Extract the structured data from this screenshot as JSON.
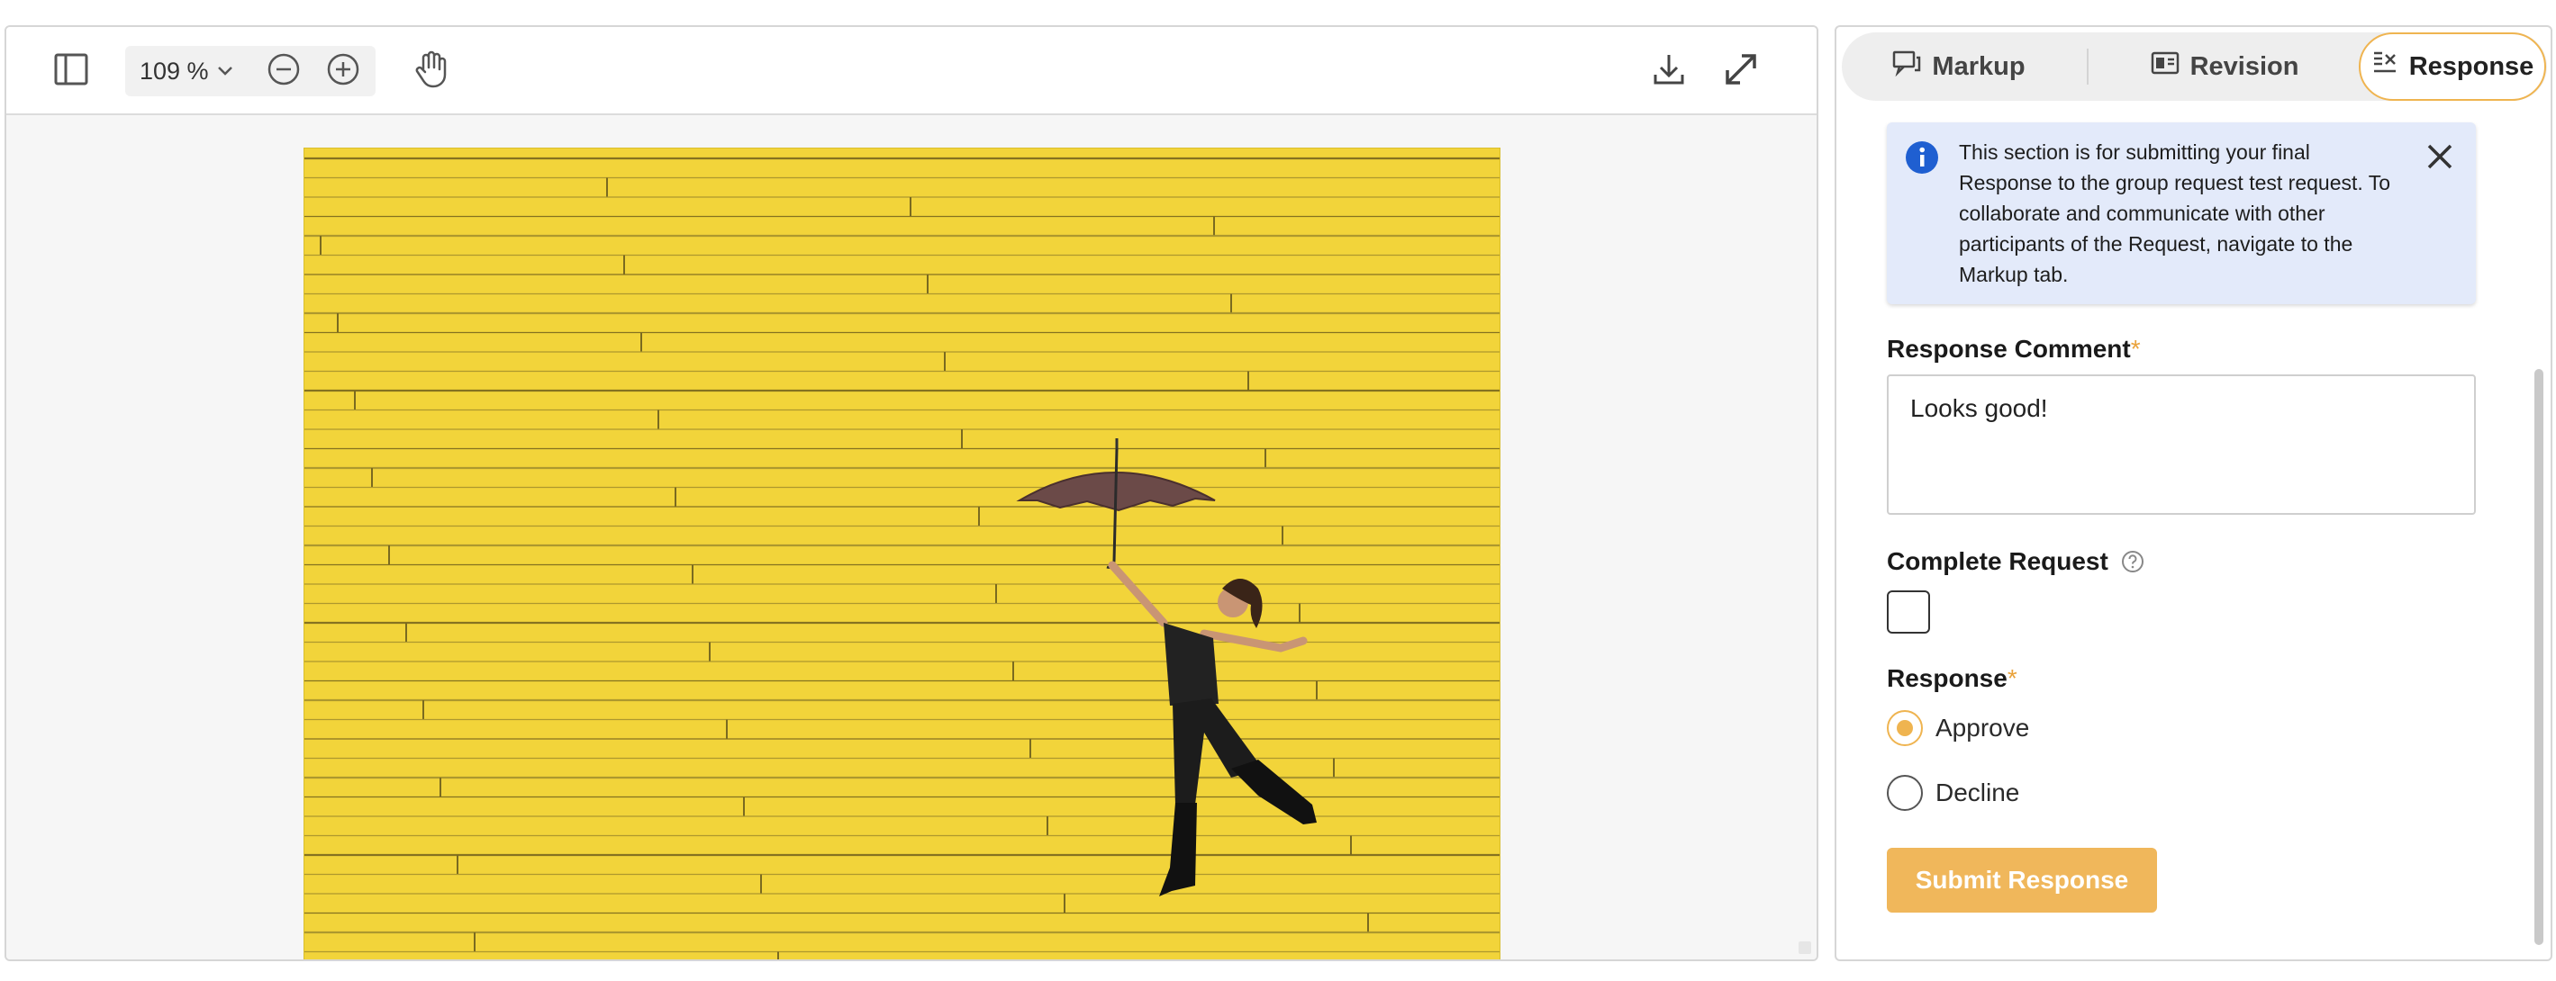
{
  "toolbar": {
    "zoom_value": "109 %",
    "icons": {
      "sidebar_toggle": "sidebar-toggle-icon",
      "zoom_dropdown": "chevron-down-icon",
      "zoom_out": "zoom-out-icon",
      "zoom_in": "zoom-in-icon",
      "pan": "hand-pan-icon",
      "download": "download-icon",
      "fullscreen": "expand-icon"
    }
  },
  "tabs": [
    {
      "label": "Markup",
      "icon": "comment-icon",
      "active": false
    },
    {
      "label": "Revision",
      "icon": "revision-icon",
      "active": false
    },
    {
      "label": "Response",
      "icon": "checklist-icon",
      "active": true
    }
  ],
  "info": {
    "text": "This section is for submitting your final Response to the group request test request. To collaborate and communicate with other participants of the Request, navigate to the Markup tab."
  },
  "form": {
    "comment_label": "Response Comment",
    "required_mark": "*",
    "comment_value": "Looks good!",
    "complete_label": "Complete Request",
    "complete_checked": false,
    "response_label": "Response",
    "options": [
      {
        "label": "Approve",
        "selected": true
      },
      {
        "label": "Decline",
        "selected": false
      }
    ],
    "submit_label": "Submit Response"
  },
  "colors": {
    "accent": "#efb450",
    "info_bg": "#e3eafa",
    "info_icon": "#1f5fd1",
    "photo_wall": "#f2d43a"
  }
}
